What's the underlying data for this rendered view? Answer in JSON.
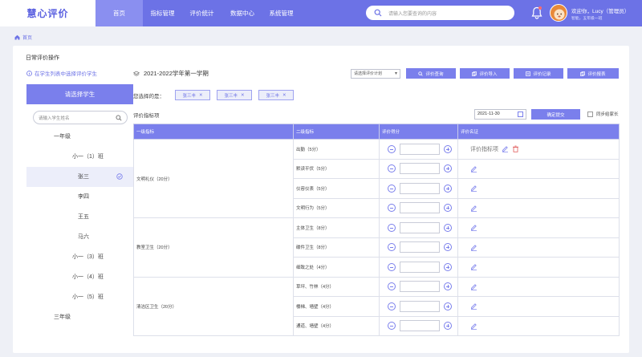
{
  "app": {
    "logo": "慧心评价"
  },
  "nav": [
    {
      "label": "首页",
      "active": true
    },
    {
      "label": "指标管理"
    },
    {
      "label": "评价统计"
    },
    {
      "label": "数据中心"
    },
    {
      "label": "系统管理"
    }
  ],
  "search": {
    "placeholder": "请输入您要查询的内容"
  },
  "user": {
    "greeting": "欢迎你，Lucy（管理员）",
    "sub": "智能，五年级一班"
  },
  "breadcrumb": {
    "home": "首页"
  },
  "page": {
    "title": "日常评价操作"
  },
  "left": {
    "hint": "在学生列表中选择评价学生",
    "select_button": "请选择学生",
    "search_placeholder": "请输入学生姓名",
    "tree": [
      "一年级",
      "小一（1）班",
      "张三",
      "李四",
      "王五",
      "马六",
      "小一（3）班",
      "小一（4）班",
      "小一（5）班",
      "三年级"
    ]
  },
  "right": {
    "term": "2021-2022学年第一学期",
    "plan_placeholder": "请选择评价计划",
    "buttons": {
      "query": "评价查询",
      "import": "评价导入",
      "record": "评价记录",
      "report": "评价报表"
    },
    "chosen_label": "您选择的是：",
    "chips": [
      "张三丰",
      "张三丰",
      "张三丰"
    ],
    "index_label": "评价指标项",
    "date": "2021-11-30",
    "confirm": "确定提交",
    "sync": "同步给家长"
  },
  "table": {
    "headers": [
      "一级指标",
      "二级指标",
      "评价得分",
      "评价名证"
    ],
    "groups": [
      {
        "name": "文明礼仪（20分）",
        "items": [
          "出勤（5分）",
          "默读平伏（5分）",
          "仪容仪表（5分）",
          "文明行为（5分）"
        ]
      },
      {
        "name": "教室卫生（20分）",
        "items": [
          "主体卫生（8分）",
          "碟件卫生（8分）",
          "细致之处（4分）"
        ]
      },
      {
        "name": "清洁区卫生（20分）",
        "items": [
          "草坪、竹林（4分）",
          "楼梯、墙壁（4分）",
          "通道、墙壁（4分）"
        ]
      }
    ],
    "first_comment": "评价指标项"
  },
  "colors": {
    "accent": "#6c72e6",
    "button": "#7a7fec",
    "delete": "#e05a5a"
  },
  "icons": [
    "search-icon",
    "bell-icon",
    "home-icon",
    "info-icon",
    "calendar-icon",
    "edit-icon",
    "delete-icon",
    "check-circle-icon",
    "close-icon"
  ]
}
